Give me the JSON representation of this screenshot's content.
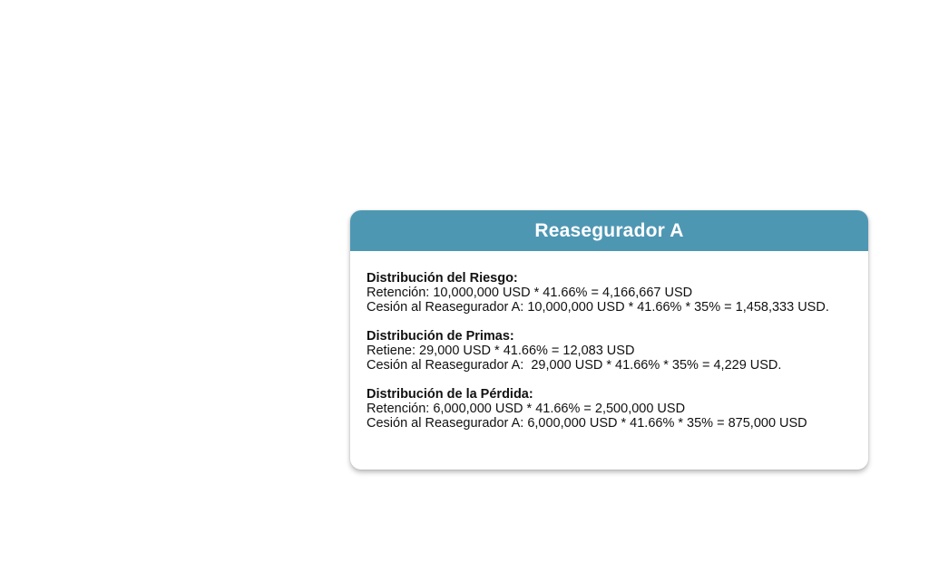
{
  "card": {
    "title": "Reasegurador A",
    "sections": [
      {
        "heading": "Distribución del Riesgo:",
        "lines": [
          "Retención: 10,000,000 USD * 41.66% = 4,166,667 USD",
          "Cesión al Reasegurador A: 10,000,000 USD * 41.66% * 35% = 1,458,333 USD."
        ]
      },
      {
        "heading": "Distribución de Primas:",
        "lines": [
          "Retiene: 29,000 USD * 41.66% = 12,083 USD",
          "Cesión al Reasegurador A:  29,000 USD * 41.66% * 35% = 4,229 USD."
        ]
      },
      {
        "heading": "Distribución de la Pérdida:",
        "lines": [
          "Retención: 6,000,000 USD * 41.66% = 2,500,000 USD",
          "Cesión al Reasegurador A: 6,000,000 USD * 41.66% * 35% = 875,000 USD"
        ]
      }
    ]
  },
  "colors": {
    "header_background": "#4e97b3",
    "header_text": "#ffffff",
    "body_text": "#111111"
  }
}
